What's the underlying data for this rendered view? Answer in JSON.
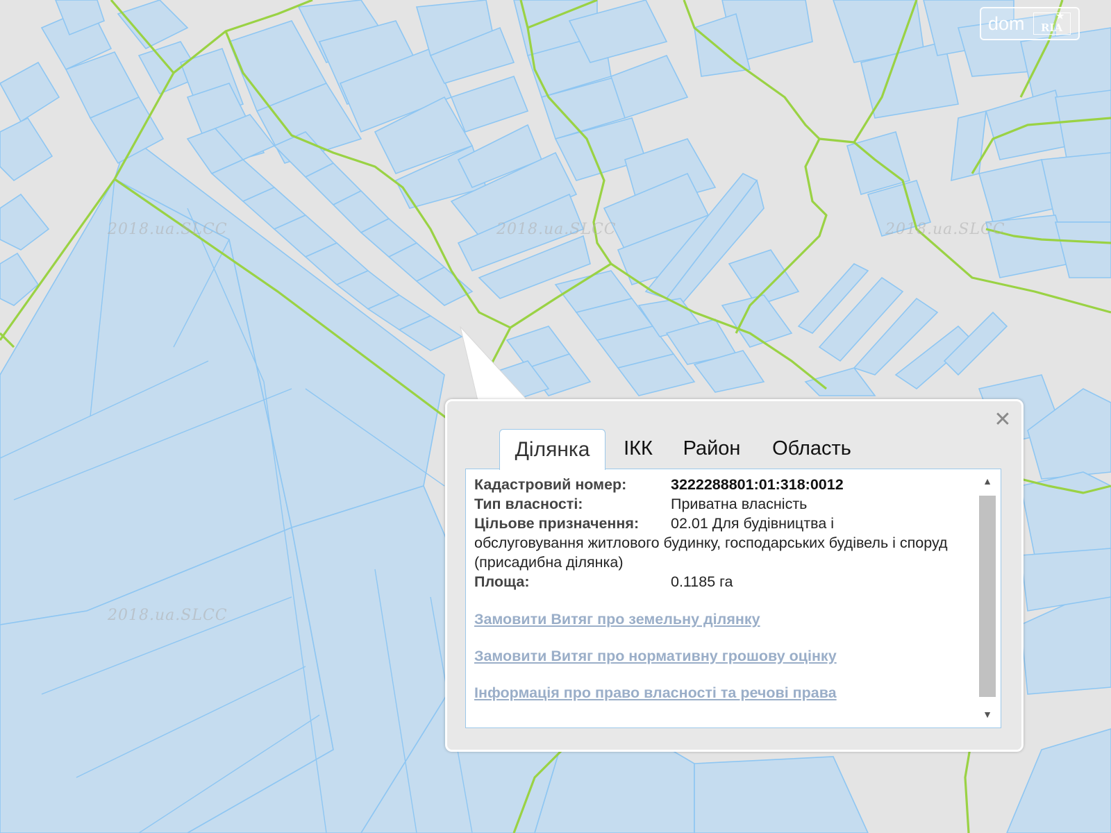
{
  "map": {
    "watermark": "2018.ua.SLCC",
    "parcel_fill": "#c5dcef",
    "parcel_stroke": "#8ec6f2",
    "boundary_stroke": "#9ad244",
    "background": "#e4e4e4"
  },
  "logo": {
    "dom": "dom",
    "ria": "RIA"
  },
  "popup": {
    "close_icon": "close-icon",
    "tabs": [
      "Ділянка",
      "ІКК",
      "Район",
      "Область"
    ],
    "active_tab": "Ділянка",
    "fields": {
      "cadastral_label": "Кадастровий номер:",
      "cadastral_value": "3222288801:01:318:0012",
      "ownership_label": "Тип власності:",
      "ownership_value": "Приватна власність",
      "purpose_label": "Цільове призначення:",
      "purpose_value_line1": "02.01 Для будівництва і",
      "purpose_value_rest": "обслуговування житлового будинку, господарських будівель і споруд (присадибна ділянка)",
      "area_label": "Площа:",
      "area_value": "0.1185 га"
    },
    "links": [
      "Замовити Витяг про земельну ділянку",
      "Замовити Витяг про нормативну грошову оцінку",
      "Інформація про право власності та речові права"
    ]
  }
}
